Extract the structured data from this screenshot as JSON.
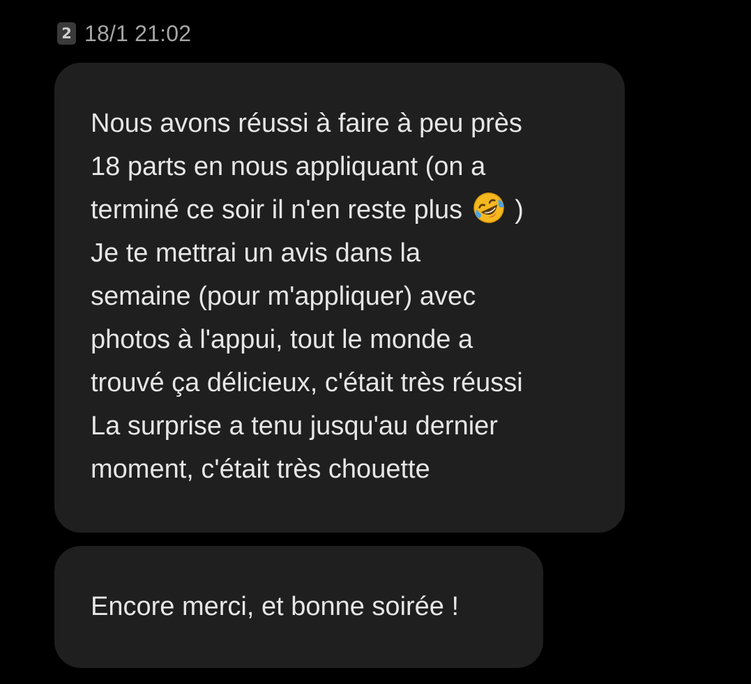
{
  "header": {
    "sim_badge": "2",
    "timestamp": "18/1 21:02"
  },
  "messages": [
    {
      "lines": [
        "Nous avons réussi à faire à peu près",
        "18 parts en nous appliquant (on a",
        "terminé ce soir il n'en reste plus",
        ")",
        "Je te mettrai un avis dans la",
        "semaine (pour m'appliquer) avec",
        "photos à l'appui, tout le monde a",
        "trouvé ça délicieux, c'était très réussi",
        "La surprise a tenu jusqu'au dernier",
        "moment, c'était très chouette"
      ],
      "emoji": "rolling-on-the-floor-laughing"
    },
    {
      "lines": [
        "Encore merci, et bonne soirée !"
      ]
    }
  ],
  "colors": {
    "background": "#000000",
    "bubble": "#1f1f1f",
    "text": "#e6e6e6",
    "timestamp": "#a6a6a6",
    "badge": "#3a3a3a"
  }
}
